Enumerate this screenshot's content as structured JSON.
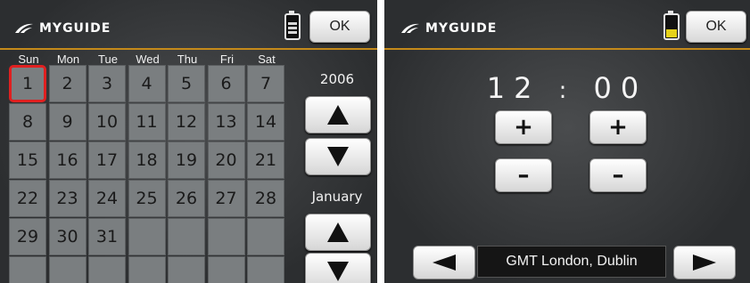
{
  "left_screen": {
    "logo_text": "MYGUIDE",
    "ok_label": "OK",
    "weekdays": [
      "Sun",
      "Mon",
      "Tue",
      "Wed",
      "Thu",
      "Fri",
      "Sat"
    ],
    "days": [
      "1",
      "2",
      "3",
      "4",
      "5",
      "6",
      "7",
      "8",
      "9",
      "10",
      "11",
      "12",
      "13",
      "14",
      "15",
      "16",
      "17",
      "18",
      "19",
      "20",
      "21",
      "22",
      "23",
      "24",
      "25",
      "26",
      "27",
      "28",
      "29",
      "30",
      "31"
    ],
    "selected_day": "1",
    "year": "2006",
    "month": "January"
  },
  "right_screen": {
    "logo_text": "MYGUIDE",
    "ok_label": "OK",
    "time": {
      "h1": "1",
      "h2": "2",
      "sep": ":",
      "m1": "0",
      "m2": "0"
    },
    "plus_label": "+",
    "minus_label": "–",
    "timezone": "GMT London, Dublin"
  },
  "colors": {
    "accent_rule": "#c58a1a",
    "selected_border": "#e02020",
    "cell_bg": "#7a7e80"
  }
}
